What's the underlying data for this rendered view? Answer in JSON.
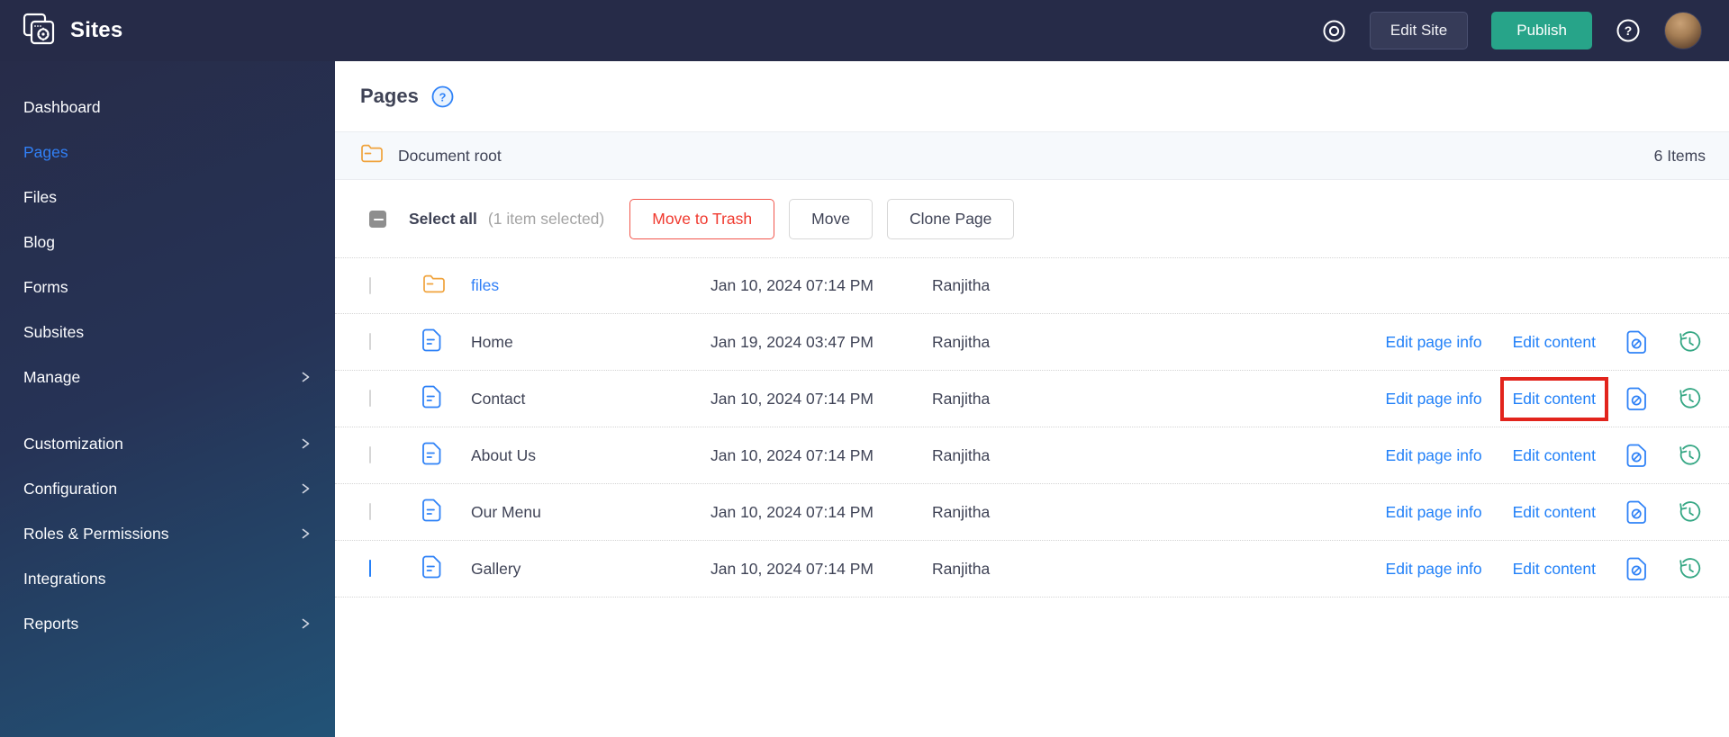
{
  "header": {
    "app_title": "Sites",
    "edit_site_label": "Edit Site",
    "publish_label": "Publish",
    "icons": [
      "sites-logo-icon",
      "preview-icon",
      "help-icon",
      "user-avatar"
    ]
  },
  "sidebar": {
    "sections": [
      [
        {
          "label": "Dashboard",
          "active": false,
          "chevron": false
        },
        {
          "label": "Pages",
          "active": true,
          "chevron": false
        },
        {
          "label": "Files",
          "active": false,
          "chevron": false
        },
        {
          "label": "Blog",
          "active": false,
          "chevron": false
        },
        {
          "label": "Forms",
          "active": false,
          "chevron": false
        },
        {
          "label": "Subsites",
          "active": false,
          "chevron": false
        },
        {
          "label": "Manage",
          "active": false,
          "chevron": true
        }
      ],
      [
        {
          "label": "Customization",
          "active": false,
          "chevron": true
        },
        {
          "label": "Configuration",
          "active": false,
          "chevron": true
        },
        {
          "label": "Roles & Permissions",
          "active": false,
          "chevron": true
        },
        {
          "label": "Integrations",
          "active": false,
          "chevron": false
        },
        {
          "label": "Reports",
          "active": false,
          "chevron": true
        }
      ]
    ]
  },
  "main": {
    "page_title": "Pages",
    "title_help_icon": "help-circle-icon",
    "folder_bar": {
      "folder_icon": "folder-open-icon",
      "label": "Document root",
      "items_count": "6 Items"
    },
    "toolbar": {
      "select_all_label": "Select all",
      "selection_status": "(1 item selected)",
      "move_to_trash_label": "Move to Trash",
      "move_label": "Move",
      "clone_page_label": "Clone Page"
    },
    "table": {
      "action_labels": {
        "edit_page_info": "Edit page info",
        "edit_content": "Edit content"
      },
      "action_icons": [
        "page-unpublish-icon",
        "version-history-icon"
      ],
      "rows": [
        {
          "name": "files",
          "type": "folder",
          "modified": "Jan 10, 2024 07:14 PM",
          "owner": "Ranjitha",
          "checked": false,
          "has_actions": false,
          "highlight_edit_content": false
        },
        {
          "name": "Home",
          "type": "page",
          "modified": "Jan 19, 2024 03:47 PM",
          "owner": "Ranjitha",
          "checked": false,
          "has_actions": true,
          "highlight_edit_content": false
        },
        {
          "name": "Contact",
          "type": "page",
          "modified": "Jan 10, 2024 07:14 PM",
          "owner": "Ranjitha",
          "checked": false,
          "has_actions": true,
          "highlight_edit_content": true
        },
        {
          "name": "About Us",
          "type": "page",
          "modified": "Jan 10, 2024 07:14 PM",
          "owner": "Ranjitha",
          "checked": false,
          "has_actions": true,
          "highlight_edit_content": false
        },
        {
          "name": "Our Menu",
          "type": "page",
          "modified": "Jan 10, 2024 07:14 PM",
          "owner": "Ranjitha",
          "checked": false,
          "has_actions": true,
          "highlight_edit_content": false
        },
        {
          "name": "Gallery",
          "type": "page",
          "modified": "Jan 10, 2024 07:14 PM",
          "owner": "Ranjitha",
          "checked": true,
          "has_actions": true,
          "highlight_edit_content": false
        }
      ]
    }
  },
  "colors": {
    "header_bg": "#262b48",
    "sidebar_gradient_top": "#272c49",
    "sidebar_gradient_bottom": "#225377",
    "accent_blue": "#2680f8",
    "publish_green": "#27a489",
    "danger_red": "#f0392e",
    "highlight_red": "#e2241c",
    "folder_orange": "#f0a33c",
    "history_green": "#35a784",
    "text_dark": "#3f4356",
    "text_gray": "#a3a3a3"
  }
}
